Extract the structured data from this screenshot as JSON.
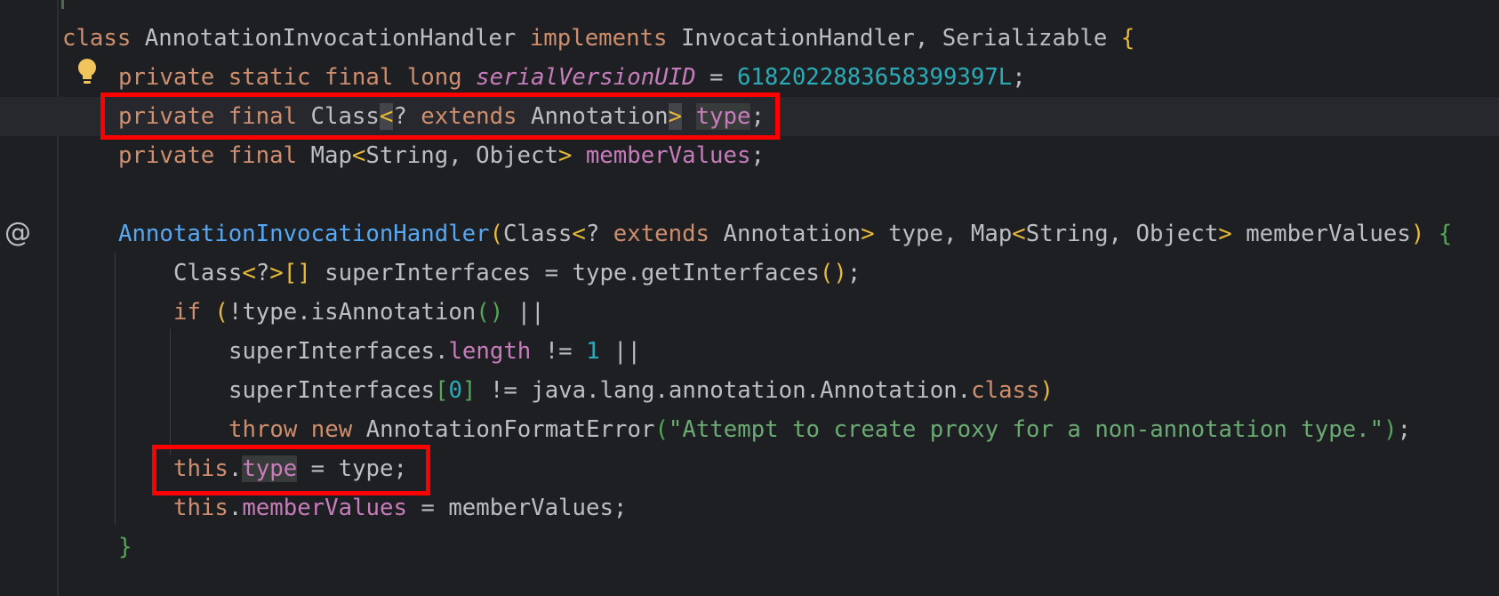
{
  "lines": [
    {
      "tokens": [
        {
          "t": "class ",
          "c": "kw"
        },
        {
          "t": "AnnotationInvocationHandler ",
          "c": "cls"
        },
        {
          "t": "implements ",
          "c": "kw"
        },
        {
          "t": "InvocationHandler, Serializable ",
          "c": "cls"
        },
        {
          "t": "{",
          "c": "br1"
        }
      ]
    },
    {
      "tokens": [
        {
          "t": "private static final long ",
          "c": "kw"
        },
        {
          "t": "serialVersionUID",
          "c": "static-field"
        },
        {
          "t": " = ",
          "c": "plain"
        },
        {
          "t": "6182022883658399397L",
          "c": "num"
        },
        {
          "t": ";",
          "c": "plain"
        }
      ]
    },
    {
      "tokens": [
        {
          "t": "private final ",
          "c": "kw"
        },
        {
          "t": "Class",
          "c": "cls"
        },
        {
          "t": "<",
          "c": "br1 match-bg"
        },
        {
          "t": "? ",
          "c": "plain"
        },
        {
          "t": "extends ",
          "c": "kw"
        },
        {
          "t": "Annotation",
          "c": "cls"
        },
        {
          "t": ">",
          "c": "br1 match-bg"
        },
        {
          "t": " ",
          "c": "plain"
        },
        {
          "t": "type",
          "c": "field hl-bg"
        },
        {
          "t": ";",
          "c": "plain"
        }
      ]
    },
    {
      "tokens": [
        {
          "t": "private final ",
          "c": "kw"
        },
        {
          "t": "Map",
          "c": "cls"
        },
        {
          "t": "<",
          "c": "br1"
        },
        {
          "t": "String, Object",
          "c": "cls"
        },
        {
          "t": "> ",
          "c": "br1"
        },
        {
          "t": "memberValues",
          "c": "field"
        },
        {
          "t": ";",
          "c": "plain"
        }
      ]
    },
    {
      "tokens": []
    },
    {
      "tokens": [
        {
          "t": "AnnotationInvocationHandler",
          "c": "fn"
        },
        {
          "t": "(",
          "c": "br1"
        },
        {
          "t": "Class",
          "c": "cls"
        },
        {
          "t": "<",
          "c": "br1"
        },
        {
          "t": "? ",
          "c": "plain"
        },
        {
          "t": "extends ",
          "c": "kw"
        },
        {
          "t": "Annotation",
          "c": "cls"
        },
        {
          "t": "> ",
          "c": "br1"
        },
        {
          "t": "type, ",
          "c": "plain"
        },
        {
          "t": "Map",
          "c": "cls"
        },
        {
          "t": "<",
          "c": "br1"
        },
        {
          "t": "String, Object",
          "c": "cls"
        },
        {
          "t": "> ",
          "c": "br1"
        },
        {
          "t": "memberValues",
          "c": "plain"
        },
        {
          "t": ") ",
          "c": "br1"
        },
        {
          "t": "{",
          "c": "br2"
        }
      ]
    },
    {
      "tokens": [
        {
          "t": "Class",
          "c": "cls"
        },
        {
          "t": "<",
          "c": "br1"
        },
        {
          "t": "?",
          "c": "plain"
        },
        {
          "t": ">[] ",
          "c": "br1"
        },
        {
          "t": "superInterfaces = type.getInterfaces",
          "c": "plain"
        },
        {
          "t": "()",
          "c": "br1"
        },
        {
          "t": ";",
          "c": "plain"
        }
      ]
    },
    {
      "tokens": [
        {
          "t": "if ",
          "c": "kw"
        },
        {
          "t": "(",
          "c": "br1"
        },
        {
          "t": "!type.isAnnotation",
          "c": "plain"
        },
        {
          "t": "()",
          "c": "br2"
        },
        {
          "t": " ||",
          "c": "plain"
        }
      ]
    },
    {
      "tokens": [
        {
          "t": "superInterfaces.",
          "c": "plain"
        },
        {
          "t": "length",
          "c": "field"
        },
        {
          "t": " != ",
          "c": "plain"
        },
        {
          "t": "1",
          "c": "num"
        },
        {
          "t": " ||",
          "c": "plain"
        }
      ]
    },
    {
      "tokens": [
        {
          "t": "superInterfaces",
          "c": "plain"
        },
        {
          "t": "[",
          "c": "br2"
        },
        {
          "t": "0",
          "c": "num"
        },
        {
          "t": "]",
          "c": "br2"
        },
        {
          "t": " != java.lang.annotation.Annotation.",
          "c": "plain"
        },
        {
          "t": "class",
          "c": "kw"
        },
        {
          "t": ")",
          "c": "br1"
        }
      ]
    },
    {
      "tokens": [
        {
          "t": "throw new ",
          "c": "kw"
        },
        {
          "t": "AnnotationFormatError",
          "c": "plain"
        },
        {
          "t": "(",
          "c": "br2"
        },
        {
          "t": "\"Attempt to create proxy for a non-annotation type.\"",
          "c": "str"
        },
        {
          "t": ")",
          "c": "br2"
        },
        {
          "t": ";",
          "c": "plain"
        }
      ]
    },
    {
      "tokens": [
        {
          "t": "this",
          "c": "kw"
        },
        {
          "t": ".",
          "c": "plain"
        },
        {
          "t": "type",
          "c": "field hl-bg"
        },
        {
          "t": " = type;",
          "c": "plain"
        }
      ]
    },
    {
      "tokens": [
        {
          "t": "this",
          "c": "kw"
        },
        {
          "t": ".",
          "c": "plain"
        },
        {
          "t": "memberValues",
          "c": "field"
        },
        {
          "t": " = memberValues;",
          "c": "plain"
        }
      ]
    },
    {
      "tokens": [
        {
          "t": "}",
          "c": "br2"
        }
      ]
    }
  ],
  "colors": {
    "background": "#1e1f22",
    "current_line": "#26282e",
    "keyword": "#cf8e6d",
    "field": "#c77dbb",
    "number": "#2aacb8",
    "string": "#6aab73",
    "method_decl": "#56a8f5",
    "bracket_outer": "#e8ba36",
    "bracket_inner": "#54a857",
    "annotation_box": "#ff0000"
  },
  "icons": {
    "intention_bulb": "lightbulb-icon",
    "implements_gutter": "at-sign-icon"
  },
  "gutter_at_symbol": "@"
}
